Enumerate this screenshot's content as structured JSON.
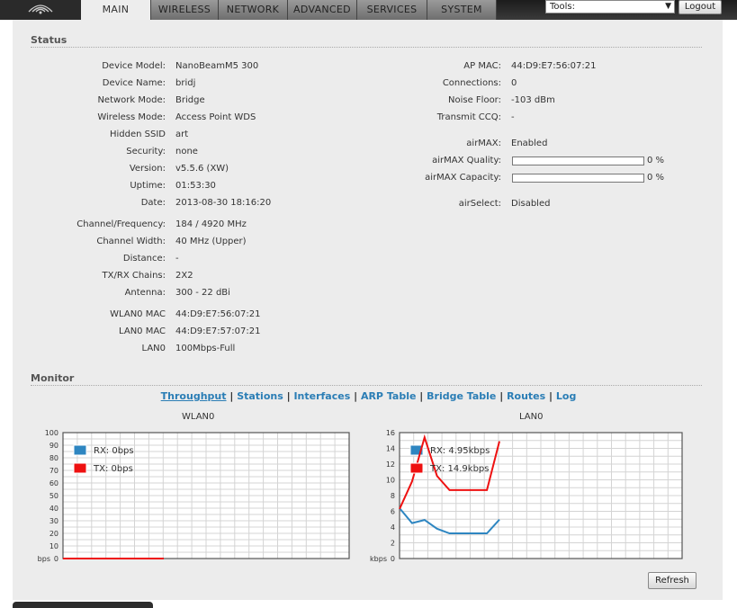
{
  "nav": {
    "tabs": [
      {
        "label": "MAIN",
        "active": true
      },
      {
        "label": "WIRELESS",
        "active": false
      },
      {
        "label": "NETWORK",
        "active": false
      },
      {
        "label": "ADVANCED",
        "active": false
      },
      {
        "label": "SERVICES",
        "active": false
      },
      {
        "label": "SYSTEM",
        "active": false
      }
    ],
    "tools_label": "Tools:",
    "logout_label": "Logout"
  },
  "status": {
    "title": "Status",
    "left": [
      {
        "label": "Device Model:",
        "value": "NanoBeamM5 300"
      },
      {
        "label": "Device Name:",
        "value": "bridj"
      },
      {
        "label": "Network Mode:",
        "value": "Bridge"
      },
      {
        "label": "Wireless Mode:",
        "value": "Access Point WDS"
      },
      {
        "label": "Hidden SSID",
        "value": "art"
      },
      {
        "label": "Security:",
        "value": "none"
      },
      {
        "label": "Version:",
        "value": "v5.5.6 (XW)"
      },
      {
        "label": "Uptime:",
        "value": "01:53:30"
      },
      {
        "label": "Date:",
        "value": "2013-08-30 18:16:20"
      },
      {
        "label": "Channel/Frequency:",
        "value": "184 / 4920 MHz"
      },
      {
        "label": "Channel Width:",
        "value": "40 MHz (Upper)"
      },
      {
        "label": "Distance:",
        "value": "-"
      },
      {
        "label": "TX/RX Chains:",
        "value": "2X2"
      },
      {
        "label": "Antenna:",
        "value": "300 - 22 dBi"
      },
      {
        "label": "WLAN0 MAC",
        "value": "44:D9:E7:56:07:21"
      },
      {
        "label": "LAN0 MAC",
        "value": "44:D9:E7:57:07:21"
      },
      {
        "label": "LAN0",
        "value": "100Mbps-Full"
      }
    ],
    "right": [
      {
        "label": "AP MAC:",
        "value": "44:D9:E7:56:07:21"
      },
      {
        "label": "Connections:",
        "value": "0"
      },
      {
        "label": "Noise Floor:",
        "value": "-103 dBm"
      },
      {
        "label": "Transmit CCQ:",
        "value": "-"
      },
      {
        "label": "airMAX:",
        "value": "Enabled"
      },
      {
        "label": "airMAX Quality:",
        "value": "0 %",
        "percent": 0
      },
      {
        "label": "airMAX Capacity:",
        "value": "0 %",
        "percent": 0
      },
      {
        "label": "airSelect:",
        "value": "Disabled"
      }
    ]
  },
  "monitor": {
    "title": "Monitor",
    "links": [
      "Throughput",
      "Stations",
      "Interfaces",
      "ARP Table",
      "Bridge Table",
      "Routes",
      "Log"
    ],
    "active_link": "Throughput",
    "refresh_label": "Refresh"
  },
  "chart_data": [
    {
      "type": "line",
      "title": "WLAN0",
      "unit_label": "bps",
      "ylim": [
        0,
        100
      ],
      "yticks": [
        0,
        10,
        20,
        30,
        40,
        50,
        60,
        70,
        80,
        90,
        100
      ],
      "grid": true,
      "legend_position": "top-left",
      "series": [
        {
          "name": "RX: 0bps",
          "color": "#2e86c1",
          "values": [
            0,
            0,
            0,
            0,
            0,
            0,
            0,
            0,
            0,
            0,
            0
          ]
        },
        {
          "name": "TX: 0bps",
          "color": "#ee1111",
          "values": [
            0,
            0,
            0,
            0,
            0,
            0,
            0,
            0,
            0,
            0,
            0
          ]
        }
      ]
    },
    {
      "type": "line",
      "title": "LAN0",
      "unit_label": "kbps",
      "ylim": [
        0,
        16
      ],
      "yticks": [
        0,
        2,
        4,
        6,
        8,
        10,
        12,
        14,
        16
      ],
      "grid": true,
      "legend_position": "top-left",
      "series": [
        {
          "name": "RX: 4.95kbps",
          "color": "#2e86c1",
          "values": [
            6.4,
            4.5,
            4.9,
            3.8,
            3.2,
            3.2,
            3.2,
            3.2,
            4.95
          ]
        },
        {
          "name": "TX: 14.9kbps",
          "color": "#ee1111",
          "values": [
            6.3,
            9.8,
            15.4,
            10.5,
            8.7,
            8.7,
            8.7,
            8.7,
            14.9
          ]
        }
      ]
    }
  ]
}
